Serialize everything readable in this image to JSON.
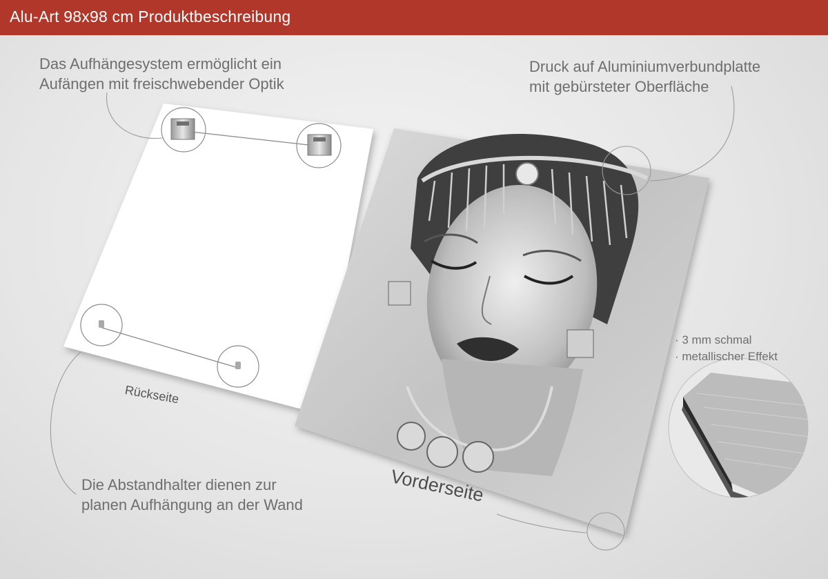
{
  "header": {
    "title": "Alu-Art 98x98 cm Produktbeschreibung",
    "background_color": "#b0372a"
  },
  "callouts": {
    "hanging_system": {
      "line1": "Das Aufhängesystem ermöglicht ein",
      "line2": "Aufängen mit freischwebender Optik"
    },
    "print_surface": {
      "line1": "Druck auf Aluminiumverbundplatte",
      "line2": "mit gebürsteter Oberfläche"
    },
    "spacers": {
      "line1": "Die Abstandhalter dienen zur",
      "line2": "planen Aufhängung an der Wand"
    },
    "features": [
      "· 3 mm schmal",
      "· metallischer Effekt"
    ]
  },
  "panels": {
    "back_label": "Rückseite",
    "front_label": "Vorderseite"
  },
  "icons": {
    "hanger": "hanger-bracket-icon",
    "spacer": "spacer-pin-icon",
    "edge_detail": "aluminium-edge-icon",
    "portrait": "portrait-image"
  }
}
